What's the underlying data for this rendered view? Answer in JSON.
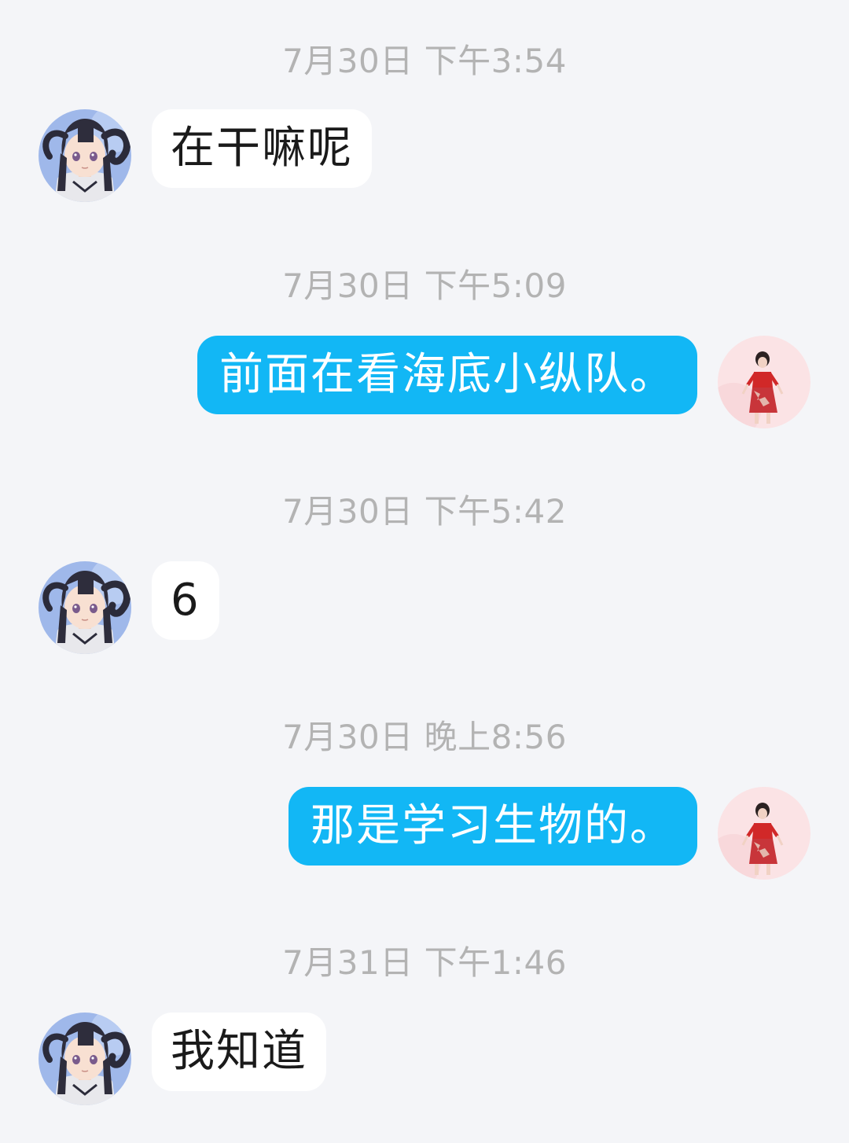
{
  "chat": {
    "messages": [
      {
        "timestamp": "7月30日 下午3:54",
        "direction": "incoming",
        "text": "在干嘛呢"
      },
      {
        "timestamp": "7月30日 下午5:09",
        "direction": "outgoing",
        "text": "前面在看海底小纵队。"
      },
      {
        "timestamp": "7月30日 下午5:42",
        "direction": "incoming",
        "text": "6"
      },
      {
        "timestamp": "7月30日 晚上8:56",
        "direction": "outgoing",
        "text": "那是学习生物的。"
      },
      {
        "timestamp": "7月31日 下午1:46",
        "direction": "incoming",
        "text": "我知道"
      }
    ]
  },
  "colors": {
    "background": "#f4f5f8",
    "incoming_bubble": "#ffffff",
    "outgoing_bubble": "#12b7f5",
    "timestamp_text": "#b3b3b3"
  },
  "icons": {
    "contact_avatar": "anime-girl-dark-hair-horns-avatar",
    "own_avatar": "girl-red-dress-avatar"
  }
}
